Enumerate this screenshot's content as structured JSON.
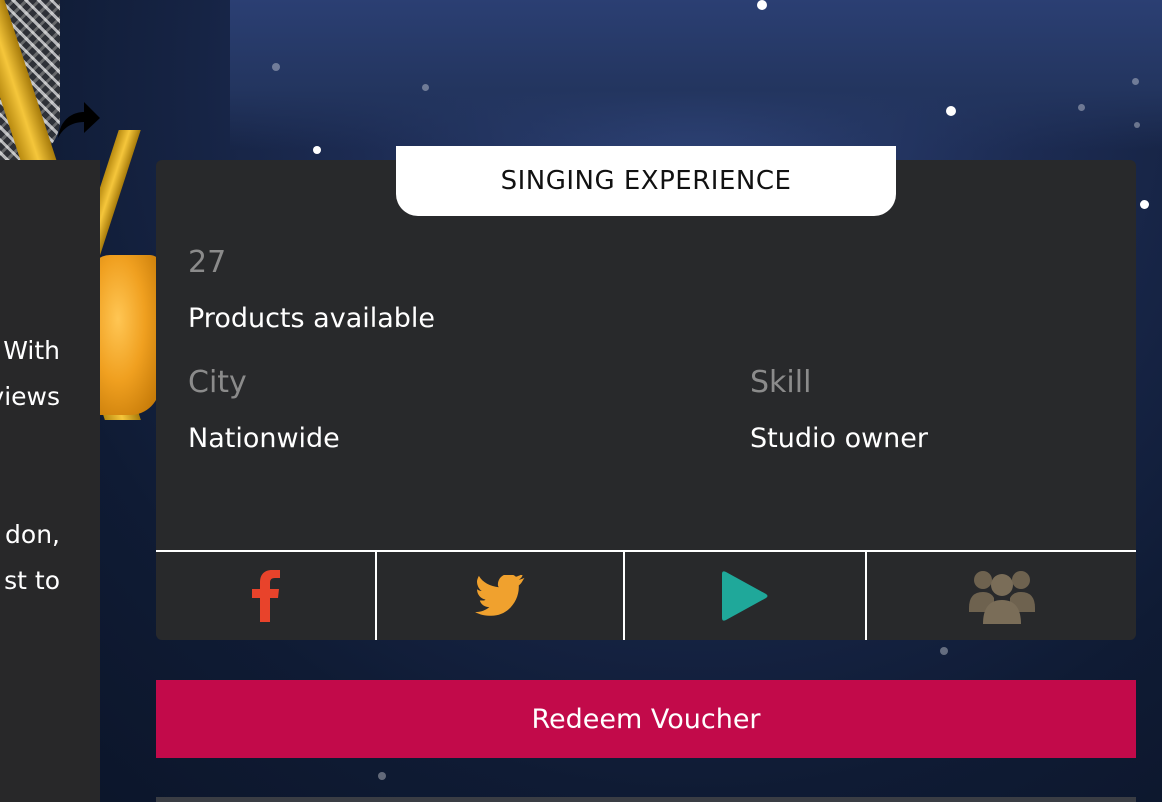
{
  "left_panel": {
    "lines": [
      "With",
      "views",
      "don,",
      "st to"
    ]
  },
  "card": {
    "tab_title": "SINGING EXPERIENCE",
    "products_count": "27",
    "products_label": "Products available",
    "city_label": "City",
    "city_value": "Nationwide",
    "skill_label": "Skill",
    "skill_value": "Studio owner"
  },
  "social": [
    {
      "icon": "facebook-icon",
      "color": "#e8432b"
    },
    {
      "icon": "twitter-icon",
      "color": "#f0a12e"
    },
    {
      "icon": "play-icon",
      "color": "#1fa89a"
    },
    {
      "icon": "group-icon",
      "color": "#6e624f"
    }
  ],
  "actions": {
    "redeem_label": "Redeem Voucher"
  },
  "colors": {
    "accent": "#c20a4a",
    "card_bg": "#28292b"
  }
}
